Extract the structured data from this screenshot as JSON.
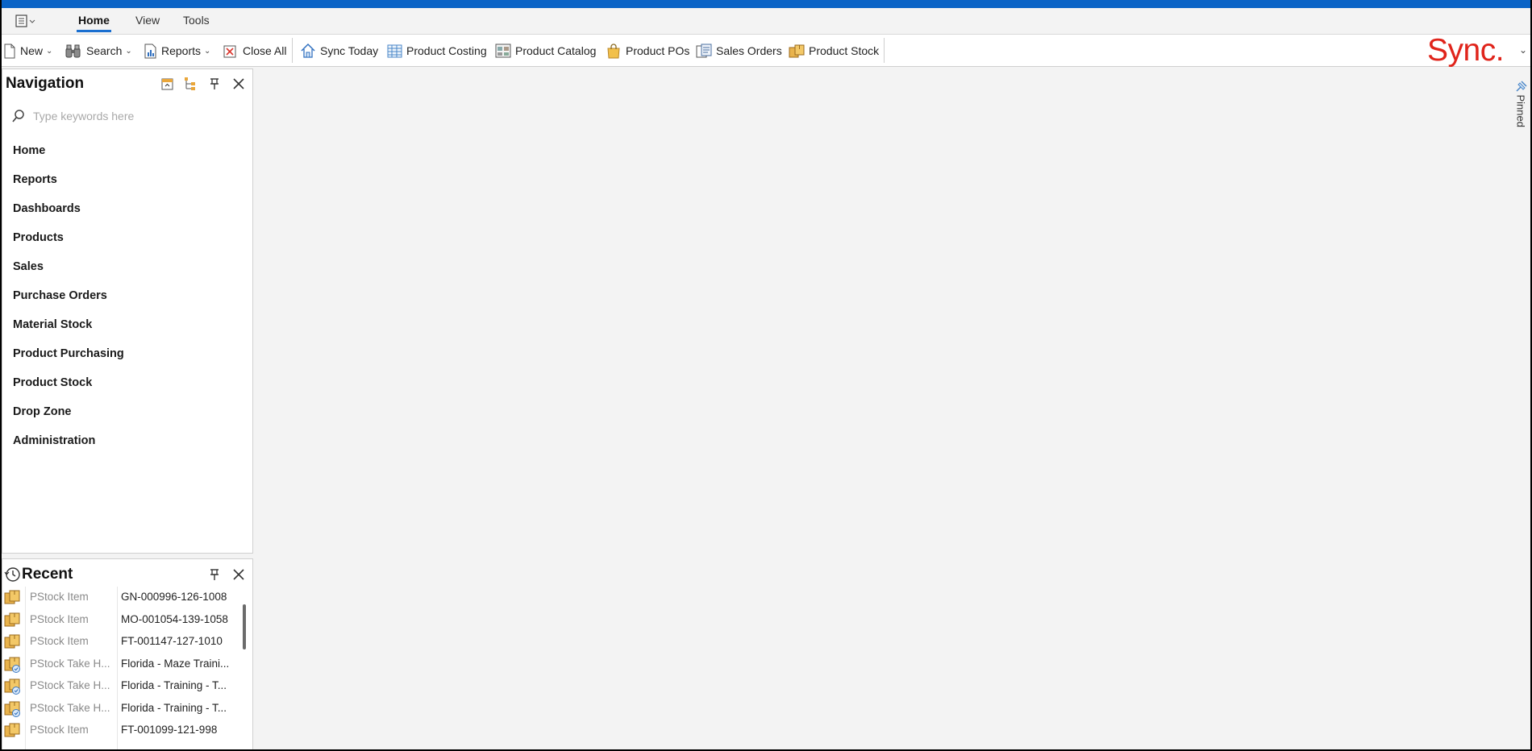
{
  "ribbon": {
    "tabs": [
      {
        "label": "Home",
        "active": true
      },
      {
        "label": "View",
        "active": false
      },
      {
        "label": "Tools",
        "active": false
      }
    ]
  },
  "toolbar": {
    "new_label": "New",
    "search_label": "Search",
    "reports_label": "Reports",
    "close_all_label": "Close All",
    "sync_today_label": "Sync Today",
    "product_costing_label": "Product Costing",
    "product_catalog_label": "Product Catalog",
    "product_pos_label": "Product POs",
    "sales_orders_label": "Sales Orders",
    "product_stock_label": "Product Stock"
  },
  "brand": {
    "name": "Sync.",
    "color": "#e0241b"
  },
  "navigation": {
    "title": "Navigation",
    "search_placeholder": "Type keywords here",
    "items": [
      "Home",
      "Reports",
      "Dashboards",
      "Products",
      "Sales",
      "Purchase Orders",
      "Material Stock",
      "Product Purchasing",
      "Product Stock",
      "Drop Zone",
      "Administration"
    ]
  },
  "recent": {
    "title": "Recent",
    "items": [
      {
        "type": "PStock Item",
        "value": "GN-000996-126-1008",
        "icon": "stock-item-icon"
      },
      {
        "type": "PStock Item",
        "value": "MO-001054-139-1058",
        "icon": "stock-item-icon"
      },
      {
        "type": "PStock Item",
        "value": "FT-001147-127-1010",
        "icon": "stock-item-icon"
      },
      {
        "type": "PStock Take H...",
        "value": "Florida - Maze Traini...",
        "icon": "stock-take-icon"
      },
      {
        "type": "PStock Take H...",
        "value": "Florida - Training - T...",
        "icon": "stock-take-icon"
      },
      {
        "type": "PStock Take H...",
        "value": "Florida - Training - T...",
        "icon": "stock-take-icon"
      },
      {
        "type": "PStock Item",
        "value": "FT-001099-121-998",
        "icon": "stock-item-icon"
      }
    ]
  },
  "side_tab": {
    "label": "Pinned"
  },
  "colors": {
    "accent": "#0a63c6",
    "tab_underline": "#1a6fd0"
  }
}
